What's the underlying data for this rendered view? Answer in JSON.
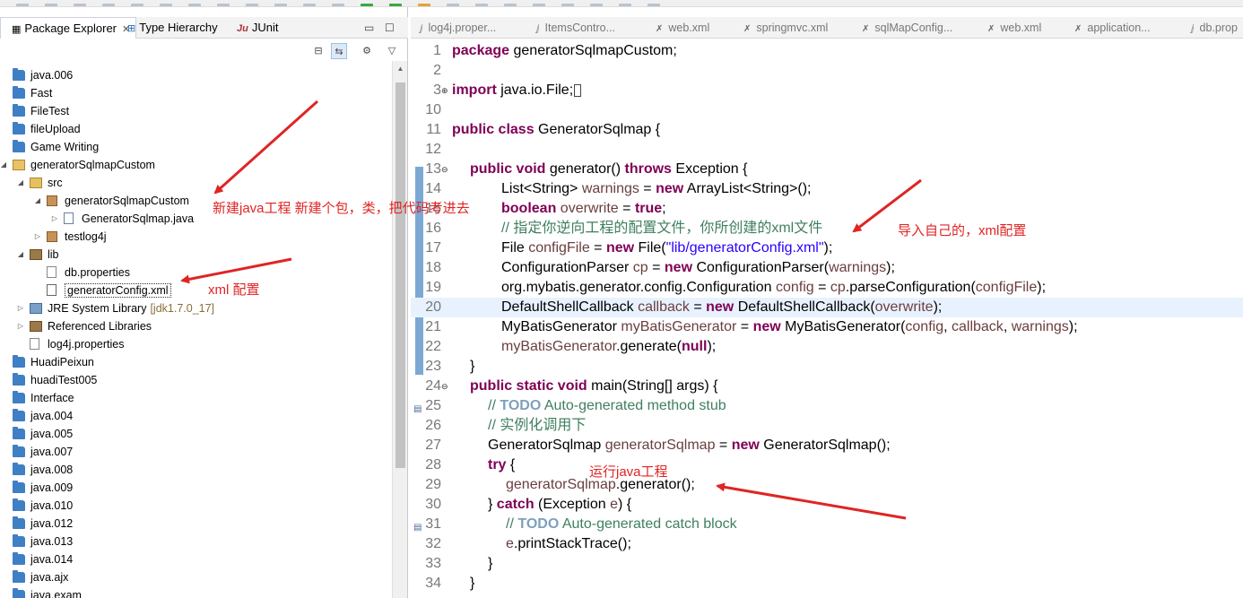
{
  "left_view": {
    "tabs": [
      {
        "label": "Package Explorer",
        "close": "✕"
      },
      {
        "label": "Type Hierarchy"
      },
      {
        "label": "JUnit",
        "prefix": "Ju"
      }
    ],
    "tree": [
      {
        "label": "java.006",
        "icon": "folder-icon"
      },
      {
        "label": "Fast",
        "icon": "folder-icon"
      },
      {
        "label": "FileTest",
        "icon": "folder-icon"
      },
      {
        "label": "fileUpload",
        "icon": "folder-icon"
      },
      {
        "label": "Game Writing",
        "icon": "folder-icon"
      },
      {
        "label": "generatorSqlmapCustom",
        "icon": "java-project-icon"
      },
      {
        "label": "src",
        "icon": "source-folder-icon"
      },
      {
        "label": "generatorSqlmapCustom",
        "icon": "package-icon"
      },
      {
        "label": "GeneratorSqlmap.java",
        "icon": "java-file-icon"
      },
      {
        "label": "testlog4j",
        "icon": "package-icon"
      },
      {
        "label": "lib",
        "icon": "library-folder-icon"
      },
      {
        "label": "db.properties",
        "icon": "file-icon"
      },
      {
        "label": "generatorConfig.xml",
        "icon": "xml-file-icon"
      },
      {
        "label": "JRE System Library",
        "suffix": "[jdk1.7.0_17]",
        "icon": "jre-library-icon"
      },
      {
        "label": "Referenced Libraries",
        "icon": "library-icon"
      },
      {
        "label": "log4j.properties",
        "icon": "file-icon"
      },
      {
        "label": "HuadiPeixun",
        "icon": "folder-icon"
      },
      {
        "label": "huadiTest005",
        "icon": "folder-icon"
      },
      {
        "label": "Interface",
        "icon": "folder-icon"
      },
      {
        "label": "java.004",
        "icon": "folder-icon"
      },
      {
        "label": "java.005",
        "icon": "folder-icon"
      },
      {
        "label": "java.007",
        "icon": "folder-icon"
      },
      {
        "label": "java.008",
        "icon": "folder-icon"
      },
      {
        "label": "java.009",
        "icon": "folder-icon"
      },
      {
        "label": "java.010",
        "icon": "folder-icon"
      },
      {
        "label": "java.012",
        "icon": "folder-icon"
      },
      {
        "label": "java.013",
        "icon": "folder-icon"
      },
      {
        "label": "java.014",
        "icon": "folder-icon"
      },
      {
        "label": "java.ajx",
        "icon": "folder-icon"
      },
      {
        "label": "java.exam",
        "icon": "folder-icon"
      }
    ]
  },
  "editor": {
    "tabs": [
      {
        "label": "log4j.proper..."
      },
      {
        "label": "ItemsContro..."
      },
      {
        "label": "web.xml"
      },
      {
        "label": "springmvc.xml"
      },
      {
        "label": "sqlMapConfig..."
      },
      {
        "label": "web.xml"
      },
      {
        "label": "application..."
      },
      {
        "label": "db.prop"
      }
    ],
    "lines": [
      {
        "n": "1",
        "t": {
          "kw1": "package",
          "rest": " generatorSqlmapCustom;"
        }
      },
      {
        "n": "2"
      },
      {
        "n": "3",
        "t": {
          "kw1": "import",
          "rest": " java.io.File;"
        }
      },
      {
        "n": "10"
      },
      {
        "n": "11",
        "t": {
          "kw1": "public class",
          "rest": " GeneratorSqlmap {"
        }
      },
      {
        "n": "12"
      },
      {
        "n": "13",
        "t": {
          "kw1": "public void",
          "mid": " generator() ",
          "kw2": "throws",
          "rest": " Exception {"
        }
      },
      {
        "n": "14",
        "t": {
          "a": "List<String> ",
          "v": "warnings",
          "b": " = ",
          "kw": "new",
          "c": " ArrayList<String>();"
        }
      },
      {
        "n": "15",
        "t": {
          "kw": "boolean",
          "v": " overwrite",
          "b": " = ",
          "kw2": "true",
          "c": ";"
        }
      },
      {
        "n": "16",
        "t": {
          "cm": "// 指定你逆向工程的配置文件，你所创建的xml文件"
        }
      },
      {
        "n": "17",
        "t": {
          "a": "File ",
          "v": "configFile",
          "b": " = ",
          "kw": "new",
          "c": " File(",
          "s": "\"lib/generatorConfig.xml\"",
          "d": ");"
        }
      },
      {
        "n": "18",
        "t": {
          "a": "ConfigurationParser ",
          "v": "cp",
          "b": " = ",
          "kw": "new",
          "c": " ConfigurationParser(",
          "v2": "warnings",
          "d": ");"
        }
      },
      {
        "n": "19",
        "t": {
          "a": "org.mybatis.generator.config.Configuration ",
          "v": "config",
          "b": " = ",
          "v2": "cp",
          "c": ".parseConfiguration(",
          "v3": "configFile",
          "d": ");"
        }
      },
      {
        "n": "20",
        "t": {
          "a": "DefaultShellCallback ",
          "v": "callback",
          "b": " = ",
          "kw": "new",
          "c": " DefaultShellCallback(",
          "v2": "overwrite",
          "d": ");"
        }
      },
      {
        "n": "21",
        "t": {
          "a": "MyBatisGenerator ",
          "v": "myBatisGenerator",
          "b": " = ",
          "kw": "new",
          "c": " MyBatisGenerator(",
          "v2": "config",
          "e": ", ",
          "v3": "callback",
          "f": ", ",
          "v4": "warnings",
          "d": ");"
        }
      },
      {
        "n": "22",
        "t": {
          "v": "myBatisGenerator",
          "c": ".generate(",
          "kw": "null",
          "d": ");"
        }
      },
      {
        "n": "23",
        "t": {
          "a": "}"
        }
      },
      {
        "n": "24",
        "t": {
          "kw1": "public static void",
          "rest": " main(String[] args) {"
        }
      },
      {
        "n": "25",
        "t": {
          "cm1": "// ",
          "todo": "TODO",
          "cm2": " Auto-generated method stub"
        }
      },
      {
        "n": "26",
        "t": {
          "cm": "// 实例化调用下"
        }
      },
      {
        "n": "27",
        "t": {
          "a": "GeneratorSqlmap ",
          "v": "generatorSqlmap",
          "b": " = ",
          "kw": "new",
          "c": " GeneratorSqlmap();"
        }
      },
      {
        "n": "28",
        "t": {
          "kw": "try",
          "c": " {"
        }
      },
      {
        "n": "29",
        "t": {
          "v": "generatorSqlmap",
          "c": ".generator();"
        }
      },
      {
        "n": "30",
        "t": {
          "a": "} ",
          "kw": "catch",
          "c": " (Exception ",
          "v": "e",
          "d": ") {"
        }
      },
      {
        "n": "31",
        "t": {
          "cm1": "// ",
          "todo": "TODO",
          "cm2": " Auto-generated catch block"
        }
      },
      {
        "n": "32",
        "t": {
          "v": "e",
          "c": ".printStackTrace();"
        }
      },
      {
        "n": "33",
        "t": {
          "a": "}"
        }
      },
      {
        "n": "34",
        "t": {
          "a": "}"
        }
      }
    ]
  },
  "annotations": {
    "new_project": "新建java工程 新建个包，类，把代码考进去",
    "xml_config": "xml 配置",
    "import_own": "导入自己的，xml配置",
    "run_project": "运行java工程"
  },
  "colors": {
    "keyword": "#7f0055",
    "string": "#2a00ff",
    "comment": "#3f7f5f",
    "annotation": "#e02424",
    "highlight_line": "#e8f2fe"
  }
}
